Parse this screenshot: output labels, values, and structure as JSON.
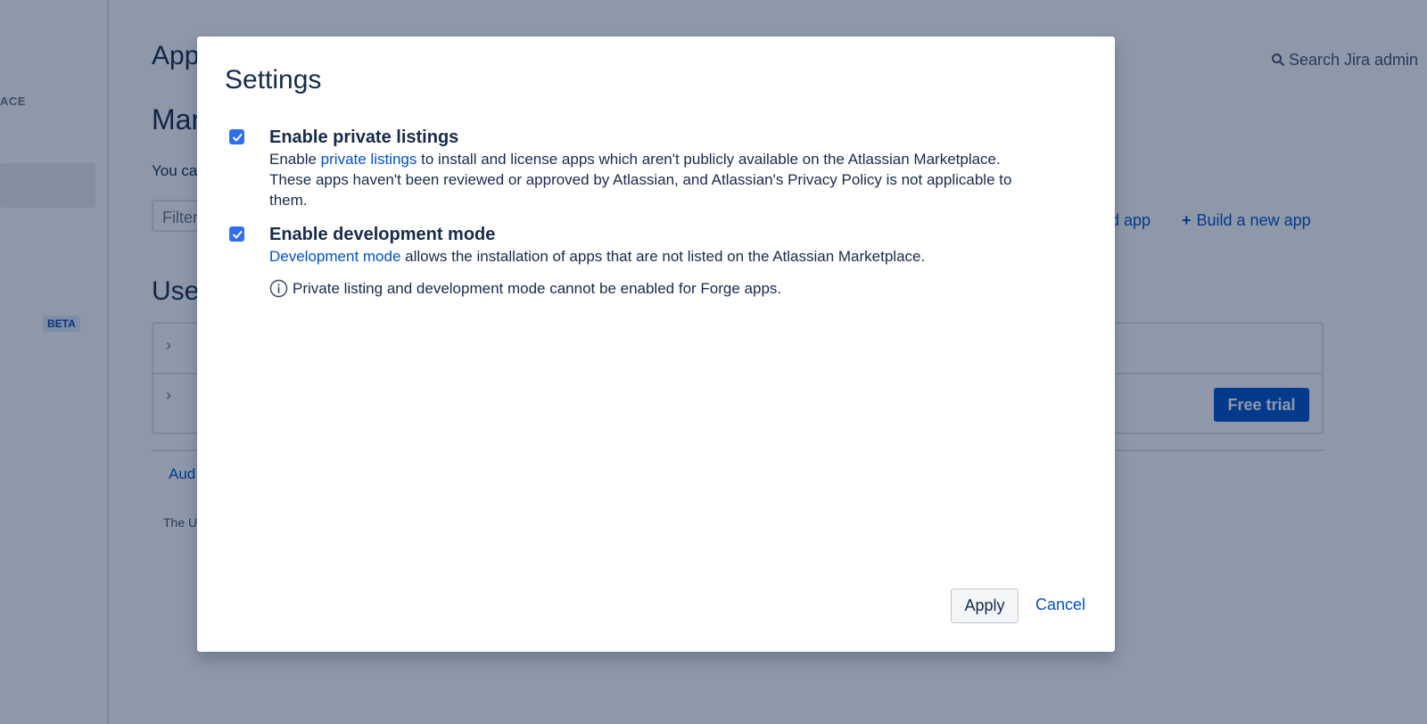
{
  "background": {
    "sidebar": {
      "section_label": "ACE",
      "beta_badge": "BETA"
    },
    "title_fragment": "App",
    "subtitle_fragment": "Mar",
    "text_fragment": "You ca",
    "filter_placeholder_fragment": "Filter",
    "search_label": "Search Jira admin",
    "upload_fragment": "oad app",
    "build_app": "Build a new app",
    "section_fragment": "User",
    "free_trial": "Free trial",
    "audit_fragment": "Aud",
    "footer_fragment": "The U"
  },
  "modal": {
    "title": "Settings",
    "options": [
      {
        "title": "Enable private listings",
        "checked": true,
        "desc_pre": "Enable ",
        "desc_link": "private listings",
        "desc_post": " to install and license apps which aren't publicly available on the Atlassian Marketplace. These apps haven't been reviewed or approved by Atlassian, and Atlassian's Privacy Policy is not applicable to them."
      },
      {
        "title": "Enable development mode",
        "checked": true,
        "desc_pre": "",
        "desc_link": "Development mode",
        "desc_post": " allows the installation of apps that are not listed on the Atlassian Marketplace."
      }
    ],
    "note": "Private listing and development mode cannot be enabled for Forge apps.",
    "apply_label": "Apply",
    "cancel_label": "Cancel"
  },
  "colors": {
    "primary_link": "#0052cc",
    "checkbox": "#2f6ff0",
    "text": "#172b4d",
    "overlay": "#091e42"
  },
  "icons": {
    "search": "search-icon",
    "plus": "plus-icon",
    "chevron": "chevron-right-icon",
    "info": "info-icon",
    "check": "check-icon"
  }
}
